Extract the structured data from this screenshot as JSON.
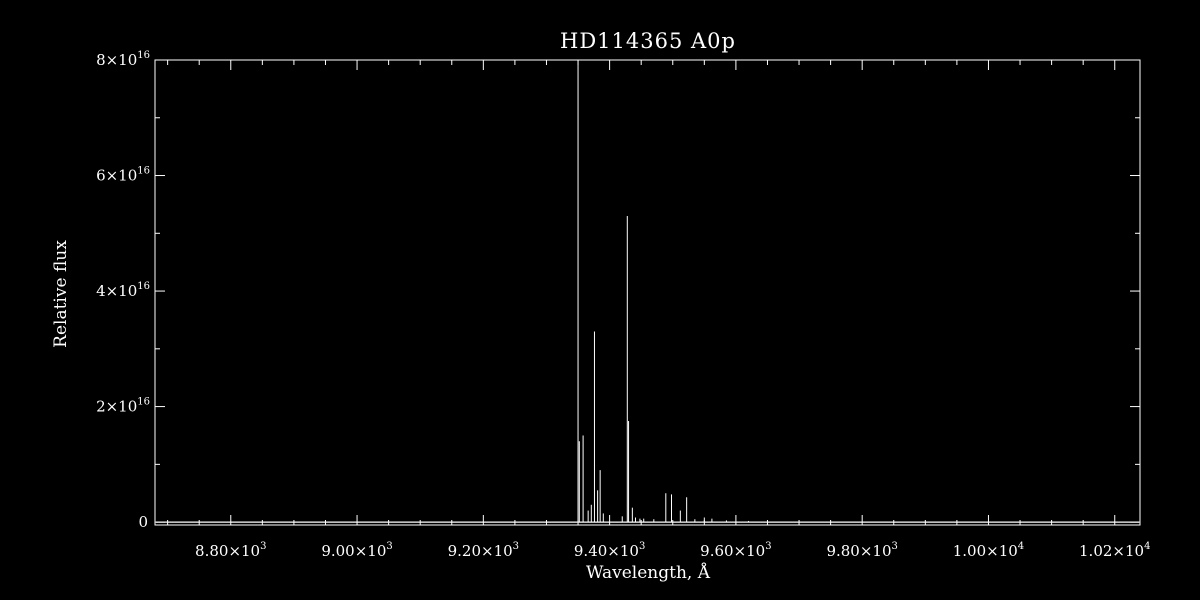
{
  "chart_data": {
    "type": "line",
    "title": "HD114365  A0p",
    "xlabel": "Wavelength, Å",
    "ylabel": "Relative flux",
    "xlim": [
      8680,
      10240
    ],
    "ylim": [
      -500000000000000,
      80000000000000000
    ],
    "grid": false,
    "colors": {
      "background": "#000000",
      "foreground": "#ffffff"
    },
    "x_ticks": [
      {
        "value": 8800,
        "mantissa": "8.80",
        "exponent": "3"
      },
      {
        "value": 9000,
        "mantissa": "9.00",
        "exponent": "3"
      },
      {
        "value": 9200,
        "mantissa": "9.20",
        "exponent": "3"
      },
      {
        "value": 9400,
        "mantissa": "9.40",
        "exponent": "3"
      },
      {
        "value": 9600,
        "mantissa": "9.60",
        "exponent": "3"
      },
      {
        "value": 9800,
        "mantissa": "9.80",
        "exponent": "3"
      },
      {
        "value": 10000,
        "mantissa": "1.00",
        "exponent": "4"
      },
      {
        "value": 10200,
        "mantissa": "1.02",
        "exponent": "4"
      }
    ],
    "y_ticks": [
      {
        "value": 0,
        "mantissa": "0",
        "exponent": ""
      },
      {
        "value": 20000000000000000,
        "mantissa": "2",
        "exponent": "16"
      },
      {
        "value": 40000000000000000,
        "mantissa": "4",
        "exponent": "16"
      },
      {
        "value": 60000000000000000,
        "mantissa": "6",
        "exponent": "16"
      },
      {
        "value": 80000000000000000,
        "mantissa": "8",
        "exponent": "16"
      }
    ],
    "series": [
      {
        "baseline": 0,
        "spikes": [
          {
            "x": 9350,
            "y": 80000000000000000
          },
          {
            "x": 9352,
            "y": 14000000000000000
          },
          {
            "x": 9358,
            "y": 15000000000000000
          },
          {
            "x": 9366,
            "y": 2000000000000000
          },
          {
            "x": 9371,
            "y": 3000000000000000
          },
          {
            "x": 9376,
            "y": 33000000000000000
          },
          {
            "x": 9381,
            "y": 5500000000000000
          },
          {
            "x": 9385,
            "y": 9000000000000000
          },
          {
            "x": 9390,
            "y": 1500000000000000
          },
          {
            "x": 9420,
            "y": 1000000000000000
          },
          {
            "x": 9428,
            "y": 53000000000000000
          },
          {
            "x": 9430,
            "y": 17500000000000000
          },
          {
            "x": 9436,
            "y": 2500000000000000
          },
          {
            "x": 9441,
            "y": 800000000000000
          },
          {
            "x": 9448,
            "y": 600000000000000
          },
          {
            "x": 9454,
            "y": 600000000000000
          },
          {
            "x": 9470,
            "y": 500000000000000
          },
          {
            "x": 9489,
            "y": 5000000000000000
          },
          {
            "x": 9498,
            "y": 4800000000000000
          },
          {
            "x": 9512,
            "y": 2000000000000000
          },
          {
            "x": 9522,
            "y": 4300000000000000
          },
          {
            "x": 9535,
            "y": 500000000000000
          },
          {
            "x": 9550,
            "y": 800000000000000
          },
          {
            "x": 9562,
            "y": 600000000000000
          },
          {
            "x": 9585,
            "y": 300000000000000
          },
          {
            "x": 9620,
            "y": 200000000000000
          }
        ]
      }
    ]
  }
}
